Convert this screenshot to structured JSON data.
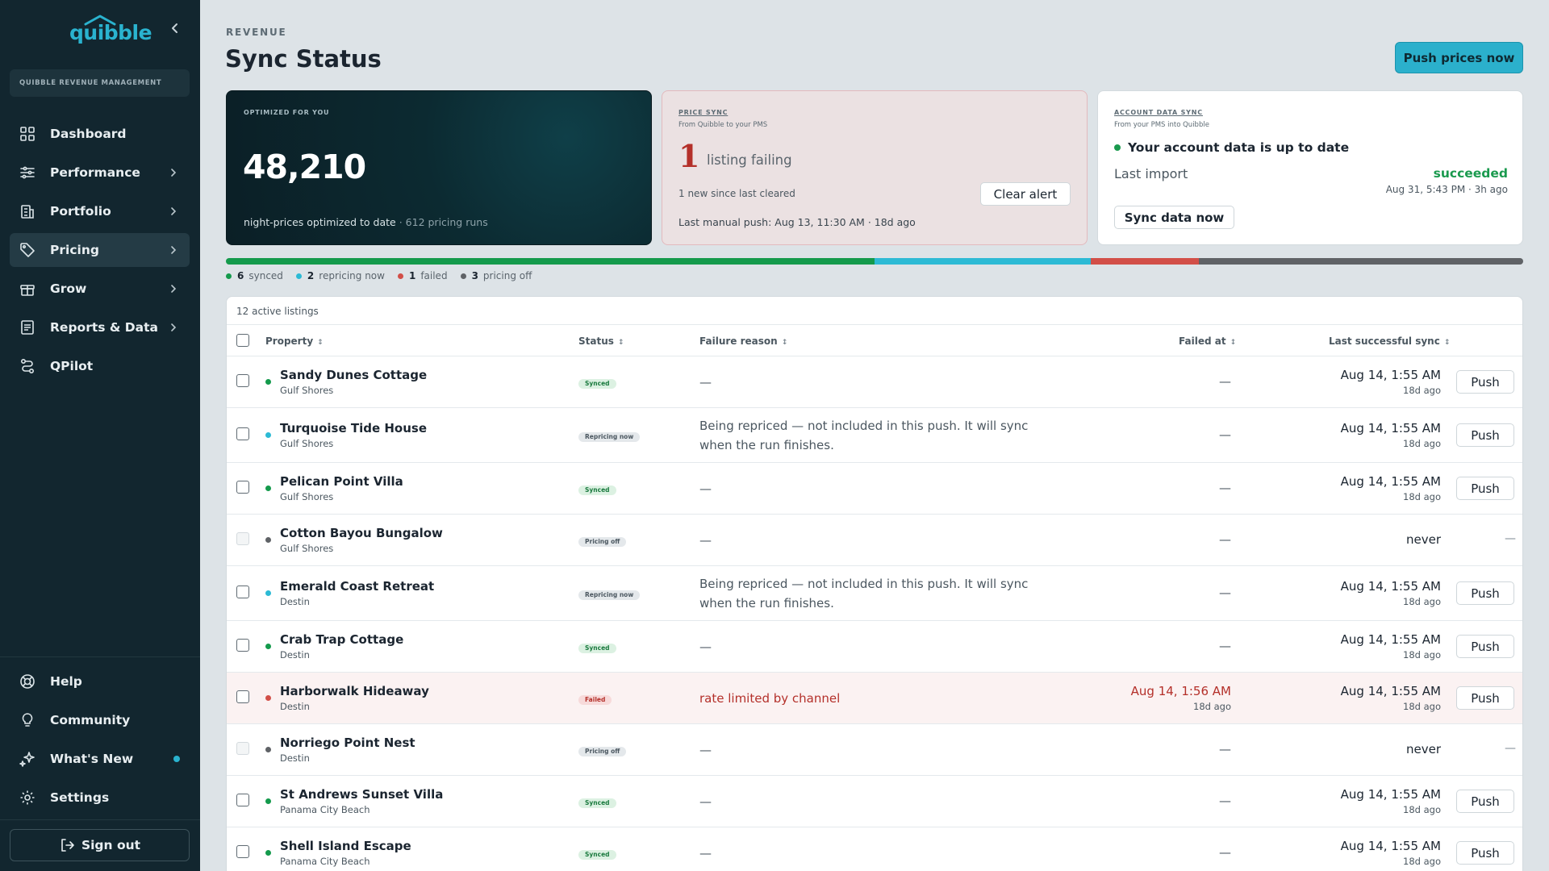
{
  "sidebar": {
    "logo": "quibble",
    "org_name": "QUIBBLE REVENUE MANAGEMENT",
    "nav": [
      {
        "label": "Dashboard",
        "icon": "grid-icon",
        "chevron": false
      },
      {
        "label": "Performance",
        "icon": "sliders-icon",
        "chevron": true
      },
      {
        "label": "Portfolio",
        "icon": "building-icon",
        "chevron": true
      },
      {
        "label": "Pricing",
        "icon": "tag-icon",
        "chevron": true,
        "active": true
      },
      {
        "label": "Grow",
        "icon": "gift-icon",
        "chevron": true
      },
      {
        "label": "Reports & Data",
        "icon": "report-icon",
        "chevron": true
      },
      {
        "label": "QPilot",
        "icon": "route-icon",
        "chevron": false
      }
    ],
    "bottom": [
      {
        "label": "Help",
        "icon": "lifebuoy-icon"
      },
      {
        "label": "Community",
        "icon": "lightbulb-icon"
      },
      {
        "label": "What's New",
        "icon": "sparkle-icon",
        "dot": true
      },
      {
        "label": "Settings",
        "icon": "gear-icon"
      }
    ],
    "sign_out": "Sign out"
  },
  "header": {
    "eyebrow": "REVENUE",
    "title": "Sync Status",
    "push_all": "Push prices now"
  },
  "cards": {
    "optimized": {
      "label": "OPTIMIZED FOR YOU",
      "value": "48,210",
      "caption": "night-prices optimized to date",
      "runs": "· 612 pricing runs"
    },
    "price_sync": {
      "label": "PRICE SYNC",
      "sub": "From Quibble to your PMS",
      "count": "1",
      "count_label": "listing failing",
      "new_text": "1 new since last cleared",
      "clear_label": "Clear alert",
      "last_push": "Last manual push: Aug 13, 11:30 AM · 18d ago"
    },
    "account_sync": {
      "label": "ACCOUNT DATA SYNC",
      "sub": "From your PMS into Quibble",
      "status": "Your account data is up to date",
      "last_import_label": "Last import",
      "result": "succeeded",
      "when": "Aug 31, 5:43 PM · 3h ago",
      "sync_label": "Sync data now"
    }
  },
  "summary": {
    "segments": [
      {
        "key": "synced",
        "count": 6,
        "label": "synced",
        "color": "#149a4c"
      },
      {
        "key": "repricing",
        "count": 2,
        "label": "repricing now",
        "color": "#2cbad5"
      },
      {
        "key": "failed",
        "count": 1,
        "label": "failed",
        "color": "#d24f48"
      },
      {
        "key": "off",
        "count": 3,
        "label": "pricing off",
        "color": "#5f6266"
      }
    ],
    "segment_fractions": [
      0.5,
      0.1667,
      0.0833,
      0.25
    ]
  },
  "table": {
    "count_label": "12 active listings",
    "columns": {
      "property": "Property",
      "status": "Status",
      "reason": "Failure reason",
      "failed_at": "Failed at",
      "last_sync": "Last successful sync"
    },
    "sort_glyph": "↕",
    "rows": [
      {
        "name": "Sandy Dunes Cottage",
        "loc": "Gulf Shores",
        "status": "synced",
        "status_label": "Synced",
        "reason": "—",
        "failed_at": "—",
        "failed_sub": "",
        "last_sync": "Aug 14, 1:55 AM",
        "last_sub": "18d ago",
        "push": "Push"
      },
      {
        "name": "Turquoise Tide House",
        "loc": "Gulf Shores",
        "status": "repricing",
        "status_label": "Repricing now",
        "reason": "Being repriced — not included in this push. It will sync when the run finishes.",
        "failed_at": "—",
        "failed_sub": "",
        "last_sync": "Aug 14, 1:55 AM",
        "last_sub": "18d ago",
        "push": "Push"
      },
      {
        "name": "Pelican Point Villa",
        "loc": "Gulf Shores",
        "status": "synced",
        "status_label": "Synced",
        "reason": "—",
        "failed_at": "—",
        "failed_sub": "",
        "last_sync": "Aug 14, 1:55 AM",
        "last_sub": "18d ago",
        "push": "Push"
      },
      {
        "name": "Cotton Bayou Bungalow",
        "loc": "Gulf Shores",
        "status": "off",
        "status_label": "Pricing off",
        "reason": "—",
        "failed_at": "—",
        "failed_sub": "",
        "last_sync": "never",
        "last_sub": "",
        "push": "—"
      },
      {
        "name": "Emerald Coast Retreat",
        "loc": "Destin",
        "status": "repricing",
        "status_label": "Repricing now",
        "reason": "Being repriced — not included in this push. It will sync when the run finishes.",
        "failed_at": "—",
        "failed_sub": "",
        "last_sync": "Aug 14, 1:55 AM",
        "last_sub": "18d ago",
        "push": "Push"
      },
      {
        "name": "Crab Trap Cottage",
        "loc": "Destin",
        "status": "synced",
        "status_label": "Synced",
        "reason": "—",
        "failed_at": "—",
        "failed_sub": "",
        "last_sync": "Aug 14, 1:55 AM",
        "last_sub": "18d ago",
        "push": "Push"
      },
      {
        "name": "Harborwalk Hideaway",
        "loc": "Destin",
        "status": "failed",
        "status_label": "Failed",
        "reason": "rate limited by channel",
        "failed_at": "Aug 14, 1:56 AM",
        "failed_sub": "18d ago",
        "last_sync": "Aug 14, 1:55 AM",
        "last_sub": "18d ago",
        "push": "Push"
      },
      {
        "name": "Norriego Point Nest",
        "loc": "Destin",
        "status": "off",
        "status_label": "Pricing off",
        "reason": "—",
        "failed_at": "—",
        "failed_sub": "",
        "last_sync": "never",
        "last_sub": "",
        "push": "—"
      },
      {
        "name": "St Andrews Sunset Villa",
        "loc": "Panama City Beach",
        "status": "synced",
        "status_label": "Synced",
        "reason": "—",
        "failed_at": "—",
        "failed_sub": "",
        "last_sync": "Aug 14, 1:55 AM",
        "last_sub": "18d ago",
        "push": "Push"
      },
      {
        "name": "Shell Island Escape",
        "loc": "Panama City Beach",
        "status": "synced",
        "status_label": "Synced",
        "reason": "—",
        "failed_at": "—",
        "failed_sub": "",
        "last_sync": "Aug 14, 1:55 AM",
        "last_sub": "18d ago",
        "push": "Push"
      }
    ]
  },
  "colors": {
    "accent": "#2bb0cc",
    "sidebar": "#12262f",
    "synced": "#149a4c",
    "repricing": "#2cbad5",
    "failed": "#d24f48",
    "off": "#5f6266"
  }
}
